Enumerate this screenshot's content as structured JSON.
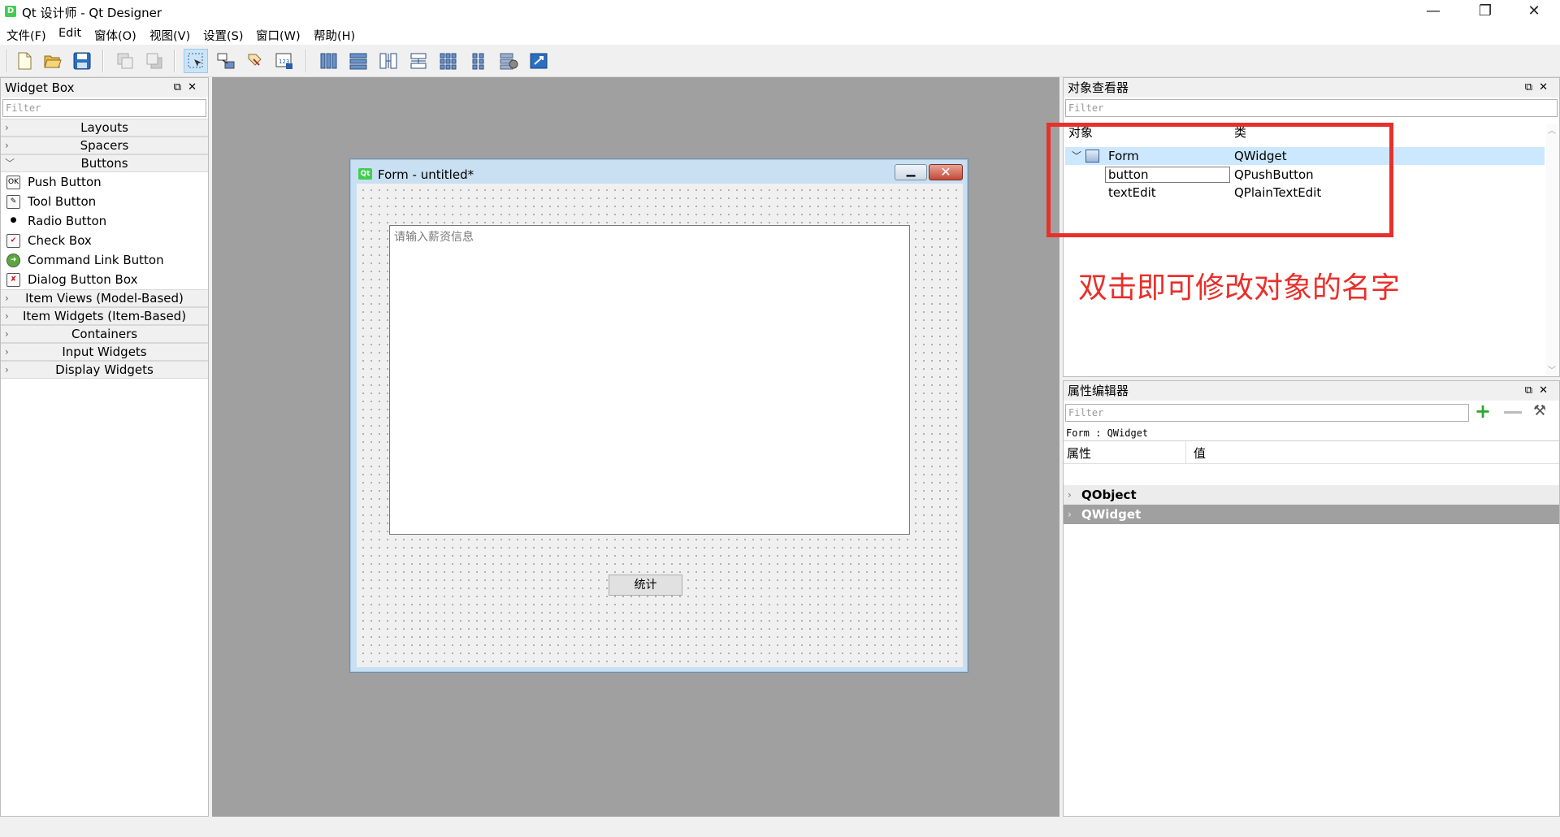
{
  "window": {
    "title": "Qt 设计师 - Qt Designer",
    "app_icon_label": "D",
    "controls": [
      "—",
      "❐",
      "✕"
    ]
  },
  "menu": [
    "文件(F)",
    "Edit",
    "窗体(O)",
    "视图(V)",
    "设置(S)",
    "窗口(W)",
    "帮助(H)"
  ],
  "toolbar": {
    "groups": [
      [
        "new-file-icon",
        "open-file-icon",
        "save-icon"
      ],
      [
        "bring-to-front-icon",
        "send-to-back-icon"
      ],
      [
        "edit-widgets-icon",
        "edit-signals-slots-icon",
        "edit-buddies-icon",
        "edit-tab-order-icon"
      ],
      [
        "layout-horizontal-icon",
        "layout-vertical-icon",
        "layout-horizontal-splitter-icon",
        "layout-vertical-splitter-icon",
        "layout-grid-icon",
        "layout-form-icon",
        "break-layout-icon",
        "adjust-size-icon"
      ]
    ],
    "active_tool": "edit-widgets-icon"
  },
  "widget_box": {
    "title": "Widget Box",
    "filter_placeholder": "Filter",
    "categories_before": [
      {
        "label": "Layouts",
        "expanded": false
      },
      {
        "label": "Spacers",
        "expanded": false
      }
    ],
    "buttons_category": {
      "label": "Buttons",
      "expanded": true
    },
    "button_items": [
      {
        "label": "Push Button",
        "icon": "push-button-icon",
        "glyph": "OK"
      },
      {
        "label": "Tool Button",
        "icon": "tool-button-icon",
        "glyph": "✎"
      },
      {
        "label": "Radio Button",
        "icon": "radio-button-icon",
        "glyph": "●"
      },
      {
        "label": "Check Box",
        "icon": "check-box-icon",
        "glyph": "✔"
      },
      {
        "label": "Command Link Button",
        "icon": "command-link-icon",
        "glyph": "➜"
      },
      {
        "label": "Dialog Button Box",
        "icon": "dialog-button-box-icon",
        "glyph": "✘"
      }
    ],
    "categories_after": [
      {
        "label": "Item Views (Model-Based)",
        "expanded": false
      },
      {
        "label": "Item Widgets (Item-Based)",
        "expanded": false
      },
      {
        "label": "Containers",
        "expanded": false
      },
      {
        "label": "Input Widgets",
        "expanded": false
      },
      {
        "label": "Display Widgets",
        "expanded": false
      }
    ]
  },
  "form": {
    "badge": "Qt",
    "title": "Form - untitled*",
    "textedit_placeholder": "请输入薪资信息",
    "button_label": "统计"
  },
  "object_inspector": {
    "title": "对象查看器",
    "filter_placeholder": "Filter",
    "columns": [
      "对象",
      "类"
    ],
    "rows": [
      {
        "object": "Form",
        "class": "QWidget",
        "level": 0,
        "selected": true
      },
      {
        "object": "button",
        "class": "QPushButton",
        "level": 1,
        "editing": true
      },
      {
        "object": "textEdit",
        "class": "QPlainTextEdit",
        "level": 1
      }
    ]
  },
  "annotation": {
    "text": "双击即可修改对象的名字",
    "color": "#e8302a"
  },
  "property_editor": {
    "title": "属性编辑器",
    "filter_placeholder": "Filter",
    "context": "Form : QWidget",
    "columns": [
      "属性",
      "值"
    ],
    "groups": [
      {
        "label": "QObject",
        "highlighted": false
      },
      {
        "label": "QWidget",
        "highlighted": true
      }
    ]
  },
  "colors": {
    "accent_selection": "#cce8ff",
    "group_highlight": "#a0a0a0",
    "qt_green": "#41cd52"
  }
}
